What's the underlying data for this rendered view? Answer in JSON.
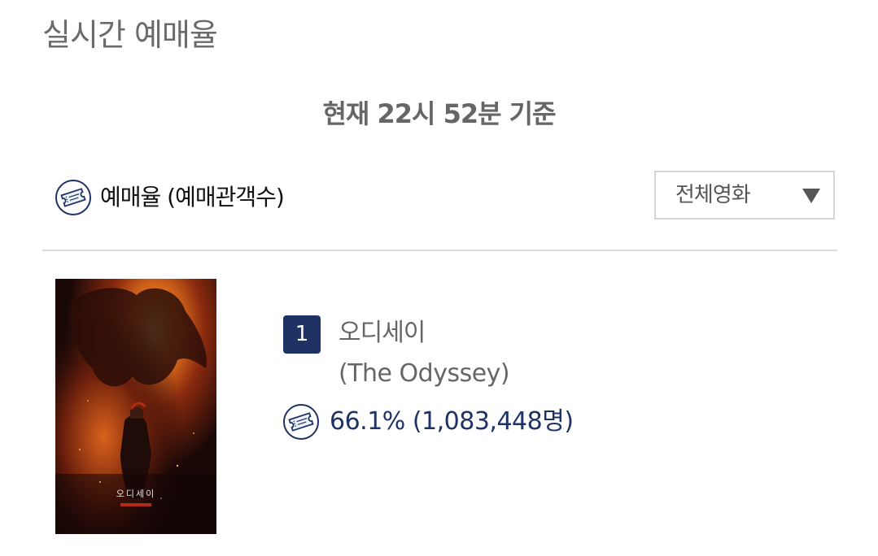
{
  "page": {
    "title": "실시간 예매율",
    "timestamp": "현재 22시 52분  기준"
  },
  "rate_header": {
    "label": "예매율 (예매관객수)",
    "icon": "ticket-icon"
  },
  "filter": {
    "selected": "전체영화",
    "arrow": "▼"
  },
  "movies": [
    {
      "rank": "1",
      "title": "오디세이",
      "title_en": "(The Odyssey)",
      "rate": "66.1% (1,083,448명)",
      "poster_title": "오디세이"
    }
  ],
  "colors": {
    "accent_navy": "#1e3264",
    "text_gray": "#666666",
    "divider": "#dcdcdc"
  }
}
